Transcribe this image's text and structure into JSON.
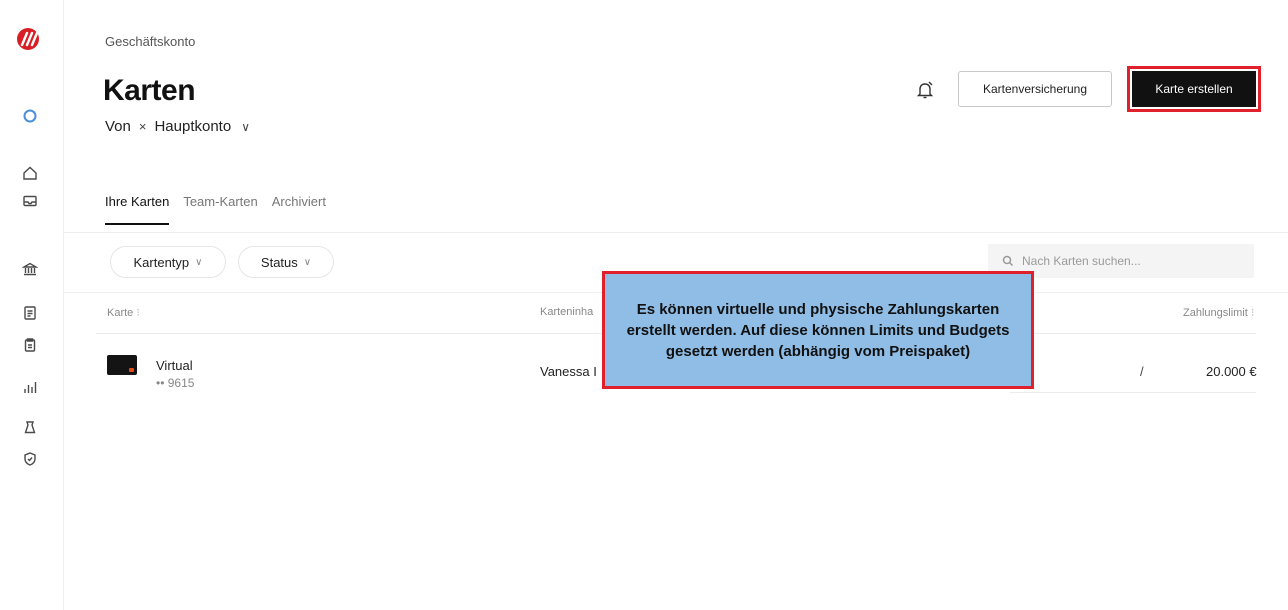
{
  "header": {
    "breadcrumb": "Geschäftskonto",
    "title": "Karten",
    "from_label": "Von",
    "account_icon": "×",
    "account_name": "Hauptkonto",
    "account_chevron": "∨"
  },
  "toolbar": {
    "insurance_label": "Kartenversicherung",
    "create_label": "Karte erstellen"
  },
  "tabs": [
    {
      "label": "Ihre Karten",
      "active": true
    },
    {
      "label": "Team-Karten",
      "active": false
    },
    {
      "label": "Archiviert",
      "active": false
    }
  ],
  "filters": {
    "card_type": "Kartentyp",
    "status": "Status",
    "chevron": "∨"
  },
  "search": {
    "placeholder": "Nach Karten suchen..."
  },
  "table": {
    "headers": {
      "card": "Karte",
      "holder": "Karteninha",
      "limit": "Zahlungslimit"
    },
    "rows": [
      {
        "name": "Virtual",
        "number": "•• 9615",
        "holder": "Vanessa I",
        "separator": "/",
        "limit": "20.000 €"
      }
    ]
  },
  "annotation": {
    "text": "Es können virtuelle und physische Zahlungskarten erstellt werden. Auf diese können Limits und Budgets gesetzt werden (abhängig vom Preispaket)"
  },
  "colors": {
    "brand": "#d81f26",
    "highlight_border": "#e0212b",
    "callout_fill": "#8fbde6",
    "primary_button": "#111111",
    "card_accent": "#e64a19"
  },
  "icons": {
    "rail": [
      "brand-logo",
      "sync-icon",
      "home-icon",
      "inbox-icon",
      "bank-icon",
      "receipt-icon",
      "document-icon",
      "chart-icon",
      "bag-icon",
      "shield-icon"
    ],
    "header": "notification-bell-icon",
    "search": "search-icon"
  }
}
